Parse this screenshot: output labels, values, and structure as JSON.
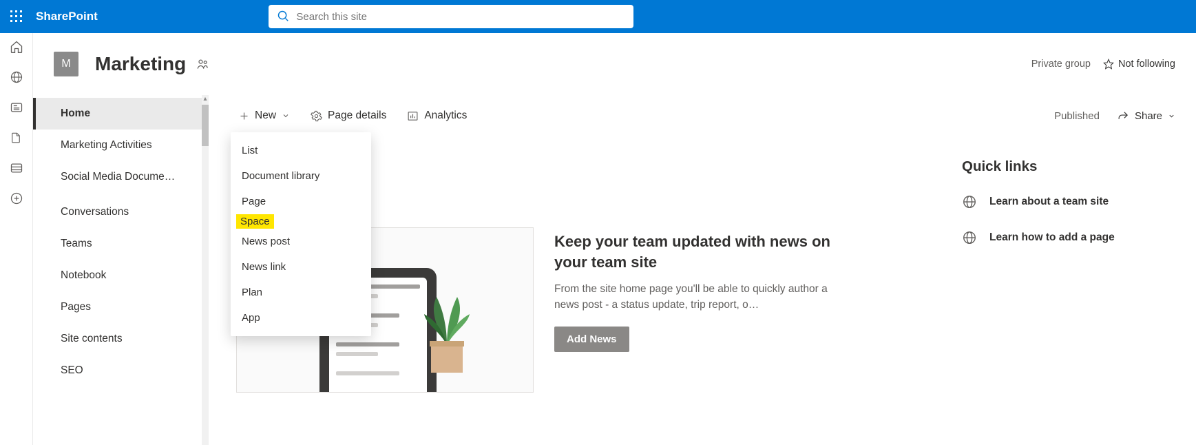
{
  "topbar": {
    "brand": "SharePoint",
    "search_placeholder": "Search this site"
  },
  "site": {
    "logo_letter": "M",
    "title": "Marketing",
    "privacy": "Private group",
    "follow_label": "Not following"
  },
  "nav": {
    "items": [
      {
        "label": "Home",
        "active": true
      },
      {
        "label": "Marketing Activities"
      },
      {
        "label": "Social Media Docume…"
      },
      {
        "label": "Conversations"
      },
      {
        "label": "Teams"
      },
      {
        "label": "Notebook"
      },
      {
        "label": "Pages"
      },
      {
        "label": "Site contents"
      },
      {
        "label": "SEO"
      }
    ]
  },
  "cmdbar": {
    "new_label": "New",
    "page_details_label": "Page details",
    "analytics_label": "Analytics",
    "published_label": "Published",
    "share_label": "Share"
  },
  "new_menu": {
    "items": [
      {
        "label": "List"
      },
      {
        "label": "Document library"
      },
      {
        "label": "Page"
      },
      {
        "label": "Space",
        "highlight": true
      },
      {
        "label": "News post"
      },
      {
        "label": "News link"
      },
      {
        "label": "Plan"
      },
      {
        "label": "App"
      }
    ]
  },
  "hero": {
    "title": "Keep your team updated with news on your team site",
    "desc": "From the site home page you'll be able to quickly author a news post - a status update, trip report, o…",
    "button": "Add News"
  },
  "quicklinks": {
    "title": "Quick links",
    "items": [
      {
        "label": "Learn about a team site"
      },
      {
        "label": "Learn how to add a page"
      }
    ]
  }
}
